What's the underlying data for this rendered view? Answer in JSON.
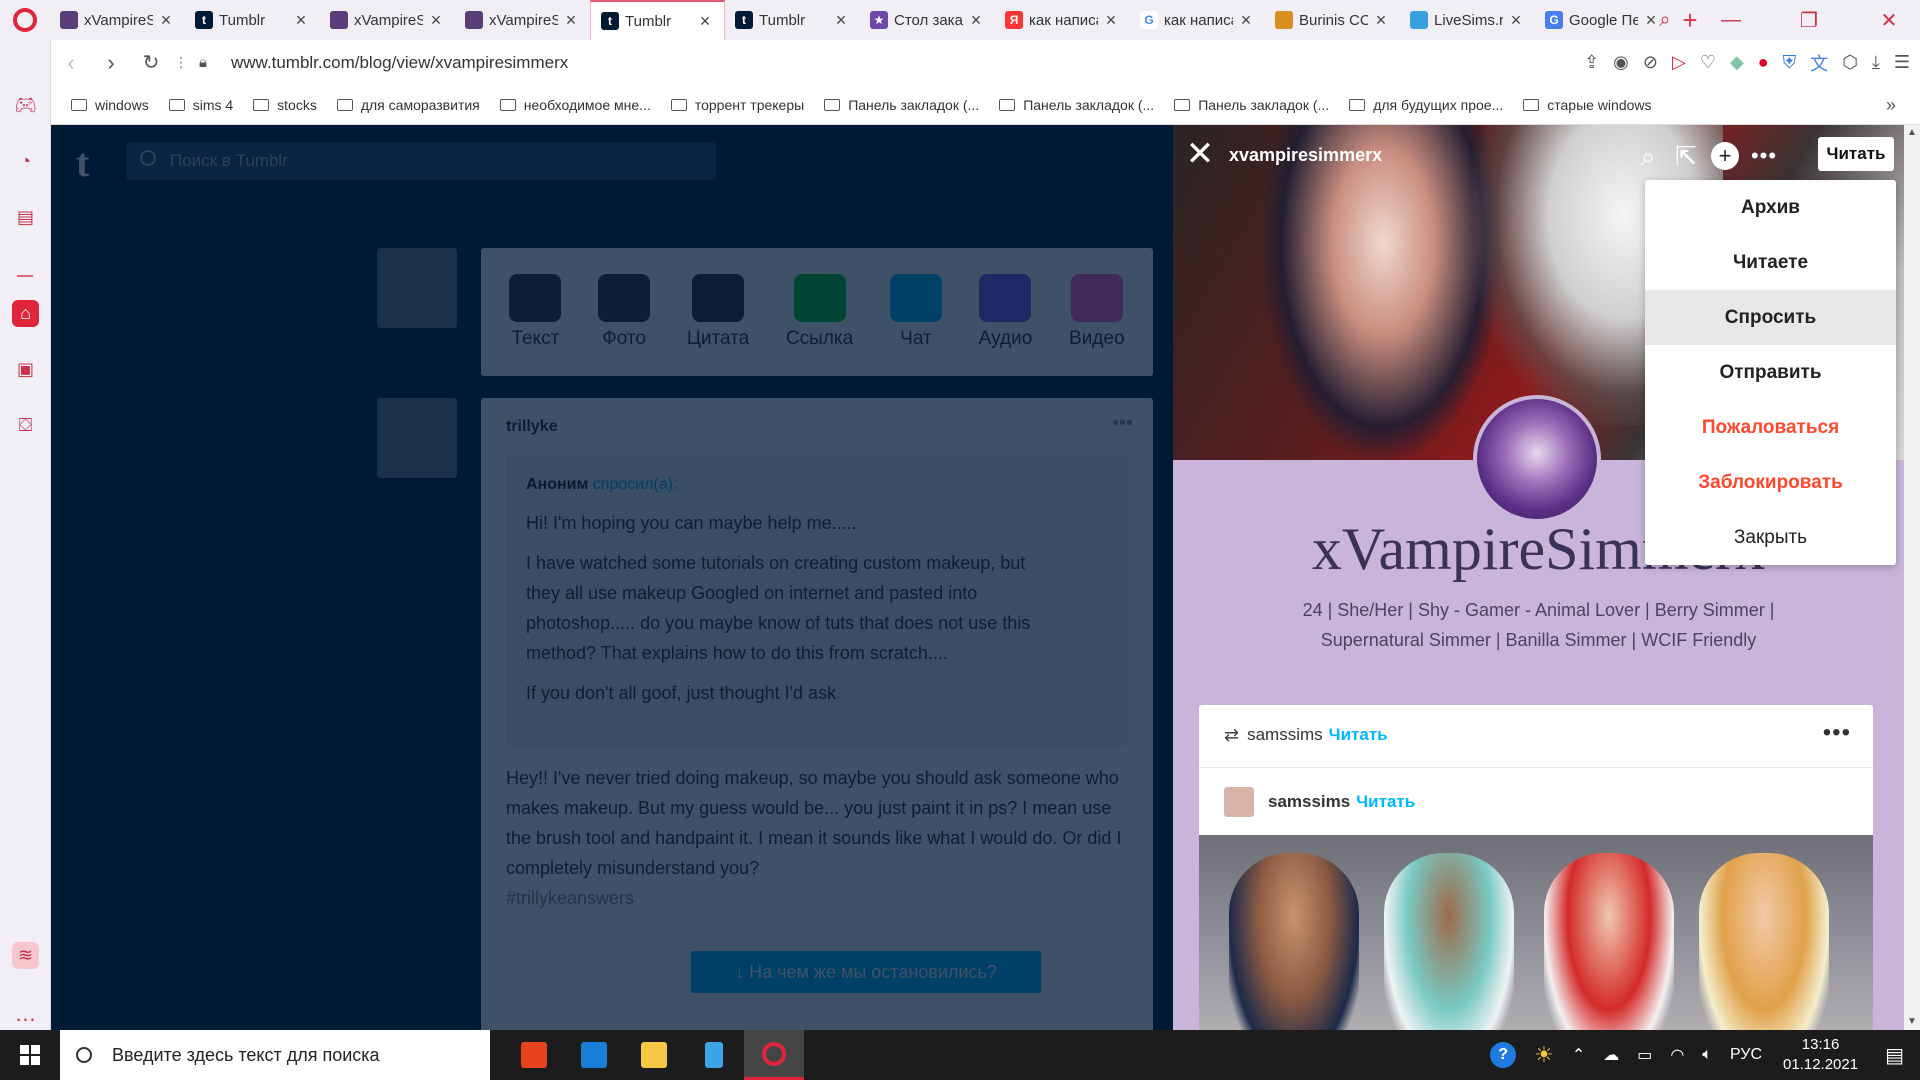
{
  "browser": {
    "tabs": [
      {
        "title": "xVampireSimmerx",
        "favicon_color": "#5b3d7a",
        "favicon_glyph": ""
      },
      {
        "title": "Tumblr",
        "favicon_color": "#001935",
        "favicon_glyph": "t"
      },
      {
        "title": "xVampireSimmerx",
        "favicon_color": "#5b3d7a",
        "favicon_glyph": ""
      },
      {
        "title": "xVampireSimmerx",
        "favicon_color": "#5b3d7a",
        "favicon_glyph": ""
      },
      {
        "title": "Tumblr",
        "favicon_color": "#001935",
        "favicon_glyph": "t",
        "active": true
      },
      {
        "title": "Tumblr",
        "favicon_color": "#001935",
        "favicon_glyph": "t"
      },
      {
        "title": "Стол заказов",
        "favicon_color": "#6d4aa8",
        "favicon_glyph": "★"
      },
      {
        "title": "как написать",
        "favicon_color": "#f33",
        "favicon_glyph": "Я"
      },
      {
        "title": "как написать",
        "favicon_color": "#ffffff",
        "favicon_glyph": "G"
      },
      {
        "title": "Burinis CC",
        "favicon_color": "#d98d1f",
        "favicon_glyph": ""
      },
      {
        "title": "LiveSims.ru",
        "favicon_color": "#3aa0dd",
        "favicon_glyph": ""
      },
      {
        "title": "Google Переводчик",
        "favicon_color": "#4a7ee8",
        "favicon_glyph": "G"
      }
    ],
    "new_tab_glyph": "+",
    "url": "www.tumblr.com/blog/view/xvampiresimmerx",
    "bookmarks": [
      "windows",
      "sims 4",
      "stocks",
      "для саморазвития",
      "необходимое мне...",
      "торрент трекеры",
      "Панель закладок (...",
      "Панель закладок (...",
      "Панель закладок (...",
      "для будущих прое...",
      "старые windows"
    ]
  },
  "dashboard": {
    "search_placeholder": "Поиск в Tumblr",
    "post_types": [
      "Текст",
      "Фото",
      "Цитата",
      "Ссылка",
      "Чат",
      "Аудио",
      "Видео"
    ],
    "post": {
      "author": "trillyke",
      "ask_from": "Аноним",
      "ask_verb": "спросил(а):",
      "ask_p1": "Hi! I'm hoping you can maybe help me.....",
      "ask_p2": "I have watched some tutorials on creating custom makeup, but they all use makeup Googled on internet and pasted into photoshop..... do you maybe know of tuts that does not use this method? That explains how to do this from scratch....",
      "ask_p3": "If you don't all goof, just thought I'd ask",
      "answer": "Hey!! I've never tried doing makeup, so maybe you should ask someone who makes makeup. But my guess would be... you just paint it in ps? I mean use the brush tool and handpaint it. I mean it sounds like what I would do. Or did I completely misunderstand you?",
      "tag": "#trillykeanswers",
      "toast": "↓ На чем же мы остановились?"
    }
  },
  "blog_panel": {
    "handle": "xvampiresimmerx",
    "follow_label": "Читать",
    "title": "xVampireSimmerx",
    "description_line1": "24 | She/Her | Shy - Gamer - Animal Lover | Berry Simmer |",
    "description_line2": "Supernatural Simmer | Banilla Simmer | WCIF Friendly",
    "menu": [
      {
        "label": "Архив",
        "style": "strong"
      },
      {
        "label": "Читаете",
        "style": "strong"
      },
      {
        "label": "Спросить",
        "style": "hover"
      },
      {
        "label": "Отправить",
        "style": "strong"
      },
      {
        "label": "Пожаловаться",
        "style": "danger"
      },
      {
        "label": "Заблокировать",
        "style": "danger"
      },
      {
        "label": "Закрыть",
        "style": "normal"
      }
    ],
    "reblog": {
      "reblogger": "samssims",
      "follow": "Читать",
      "source": "samssims",
      "source_follow": "Читать",
      "more": "•••"
    }
  },
  "taskbar": {
    "search_placeholder": "Введите здесь текст для поиска",
    "lang": "РУС",
    "time": "13:16",
    "date": "01.12.2021"
  },
  "colors": {
    "tumblr_navy": "#001935",
    "tumblr_blue": "#00b8ff",
    "danger": "#ff492f",
    "opera_red": "#e0243a",
    "blog_bg": "#c9b5da"
  }
}
